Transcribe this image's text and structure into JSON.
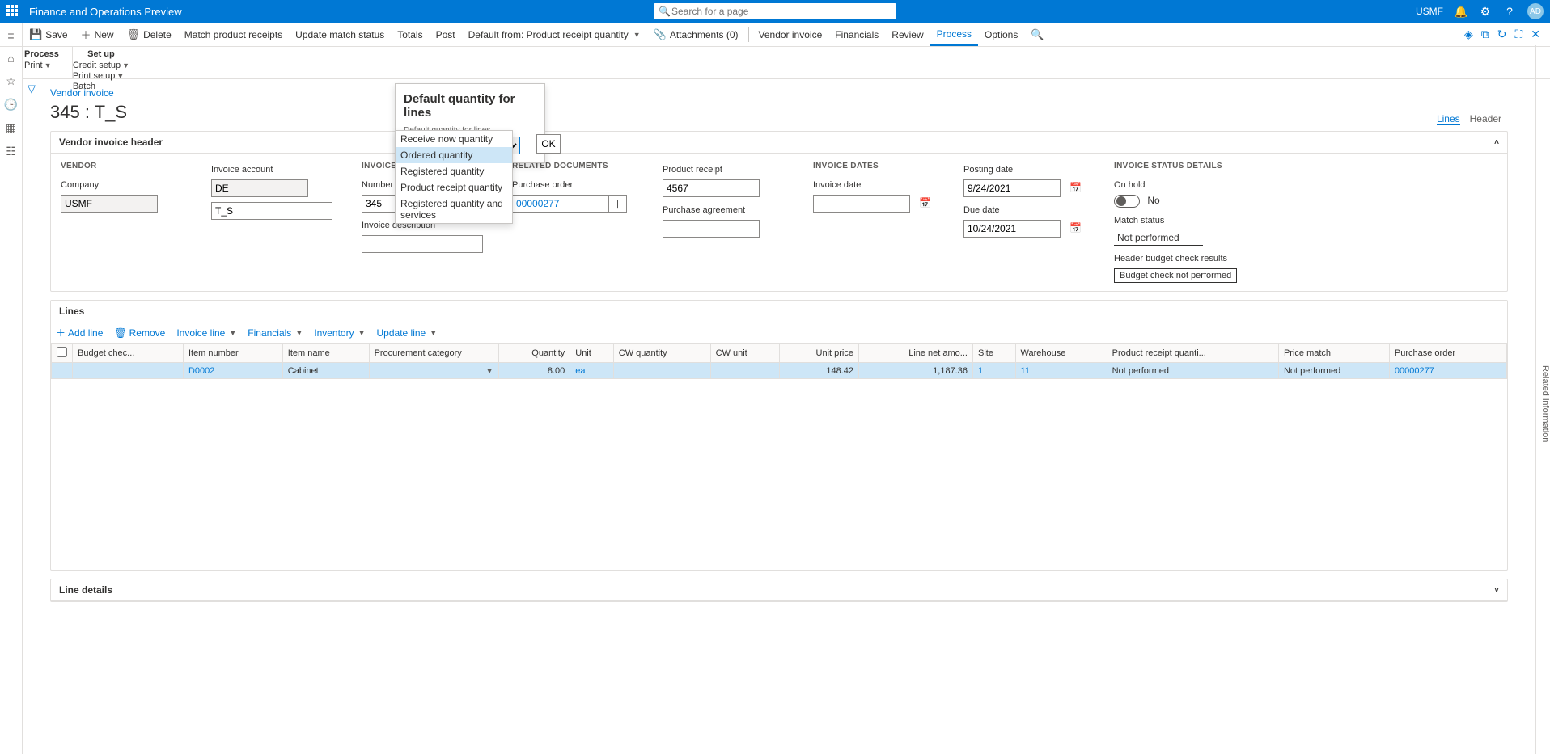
{
  "header": {
    "title": "Finance and Operations Preview",
    "search_placeholder": "Search for a page",
    "company": "USMF",
    "avatar": "AD"
  },
  "cmdbar": {
    "save": "Save",
    "new": "New",
    "delete": "Delete",
    "match": "Match product receipts",
    "update_match": "Update match status",
    "totals": "Totals",
    "post": "Post",
    "default_from": "Default from: Product receipt quantity",
    "attachments": "Attachments (0)",
    "vendor_invoice": "Vendor invoice",
    "financials": "Financials",
    "review": "Review",
    "process": "Process",
    "options": "Options"
  },
  "subbar": {
    "process_head": "Process",
    "print": "Print",
    "setup_head": "Set up",
    "credit_setup": "Credit setup",
    "print_setup": "Print setup",
    "batch": "Batch"
  },
  "popup": {
    "title": "Default quantity for lines",
    "label": "Default quantity for lines",
    "selected": "Ordered quantity",
    "ok": "OK",
    "options": [
      "Receive now quantity",
      "Ordered quantity",
      "Registered quantity",
      "Product receipt quantity",
      "Registered quantity and services"
    ]
  },
  "page": {
    "breadcrumb": "Vendor invoice",
    "title": "345 : T_S",
    "view_lines": "Lines",
    "view_header": "Header"
  },
  "right_rail": "Related information",
  "header_panel": {
    "title": "Vendor invoice header",
    "vendor_head": "VENDOR",
    "company_label": "Company",
    "company": "USMF",
    "invacct_label": "Invoice account",
    "invacct": "DE",
    "invacct2": "T_S",
    "ident_head": "INVOICE IDENTIFICATION",
    "number_label": "Number",
    "number": "345",
    "desc_label": "Invoice description",
    "desc": "",
    "related_head": "RELATED DOCUMENTS",
    "po_label": "Purchase order",
    "po": "00000277",
    "pr_label": "Product receipt",
    "pr": "4567",
    "pa_label": "Purchase agreement",
    "pa": "",
    "dates_head": "INVOICE DATES",
    "invdate_label": "Invoice date",
    "invdate": "",
    "posting_label": "Posting date",
    "posting": "9/24/2021",
    "due_label": "Due date",
    "due": "10/24/2021",
    "status_head": "INVOICE STATUS DETAILS",
    "onhold_label": "On hold",
    "onhold_val": "No",
    "match_label": "Match status",
    "match": "Not performed",
    "budget_label": "Header budget check results",
    "budget": "Budget check not performed"
  },
  "lines_panel": {
    "title": "Lines",
    "detail_title": "Line details",
    "toolbar": {
      "add": "Add line",
      "remove": "Remove",
      "invoice_line": "Invoice line",
      "financials": "Financials",
      "inventory": "Inventory",
      "update_line": "Update line"
    },
    "columns": [
      "",
      "Budget chec...",
      "Item number",
      "Item name",
      "Procurement category",
      "Quantity",
      "Unit",
      "CW quantity",
      "CW unit",
      "Unit price",
      "Line net amo...",
      "Site",
      "Warehouse",
      "Product receipt quanti...",
      "Price match",
      "Purchase order"
    ],
    "rows": [
      {
        "budget": "",
        "item": "D0002",
        "name": "Cabinet",
        "proc": "",
        "qty": "8.00",
        "unit": "ea",
        "cwq": "",
        "cwu": "",
        "price": "148.42",
        "net": "1,187.36",
        "site": "1",
        "wh": "11",
        "prq": "Not performed",
        "pm": "Not performed",
        "po": "00000277"
      }
    ]
  }
}
